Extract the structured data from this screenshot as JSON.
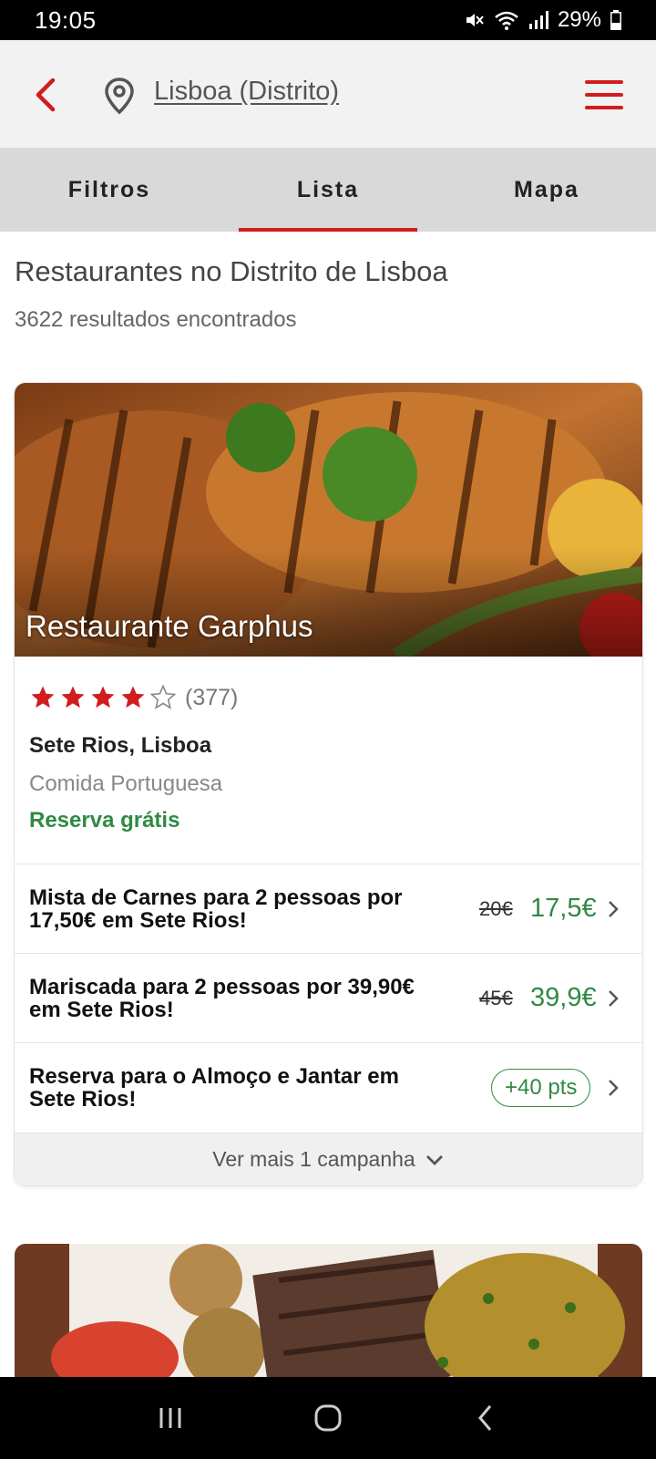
{
  "status_bar": {
    "time": "19:05",
    "battery": "29%",
    "icons": [
      "mute-icon",
      "wifi-icon",
      "signal-icon",
      "battery-icon"
    ]
  },
  "header": {
    "location": "Lisboa (Distrito)",
    "icons": [
      "back-arrow-icon",
      "location-pin-icon",
      "hamburger-menu-icon"
    ]
  },
  "tabs": [
    {
      "label": "Filtros",
      "active": false
    },
    {
      "label": "Lista",
      "active": true
    },
    {
      "label": "Mapa",
      "active": false
    }
  ],
  "results": {
    "title": "Restaurantes no Distrito de Lisboa",
    "count": "3622 resultados encontrados"
  },
  "restaurant": {
    "name": "Restaurante Garphus",
    "rating": 4,
    "rating_max": 5,
    "rating_count": "(377)",
    "area": "Sete Rios, Lisboa",
    "cuisine": "Comida Portuguesa",
    "reservation": "Reserva grátis",
    "offers": [
      {
        "text": "Mista de Carnes para 2 pessoas por 17,50€ em Sete Rios!",
        "old_price": "20€",
        "new_price": "17,5€"
      },
      {
        "text": "Mariscada para 2 pessoas por 39,90€ em Sete Rios!",
        "old_price": "45€",
        "new_price": "39,9€"
      },
      {
        "text": "Reserva para o Almoço e Jantar em Sete Rios!",
        "badge": "+40 pts"
      }
    ],
    "more": "Ver mais 1 campanha"
  },
  "colors": {
    "accent_red": "#d11d1d",
    "green": "#2f8a44",
    "tab_bar": "#d9d9d9",
    "header_bg": "#f2f2f2"
  }
}
